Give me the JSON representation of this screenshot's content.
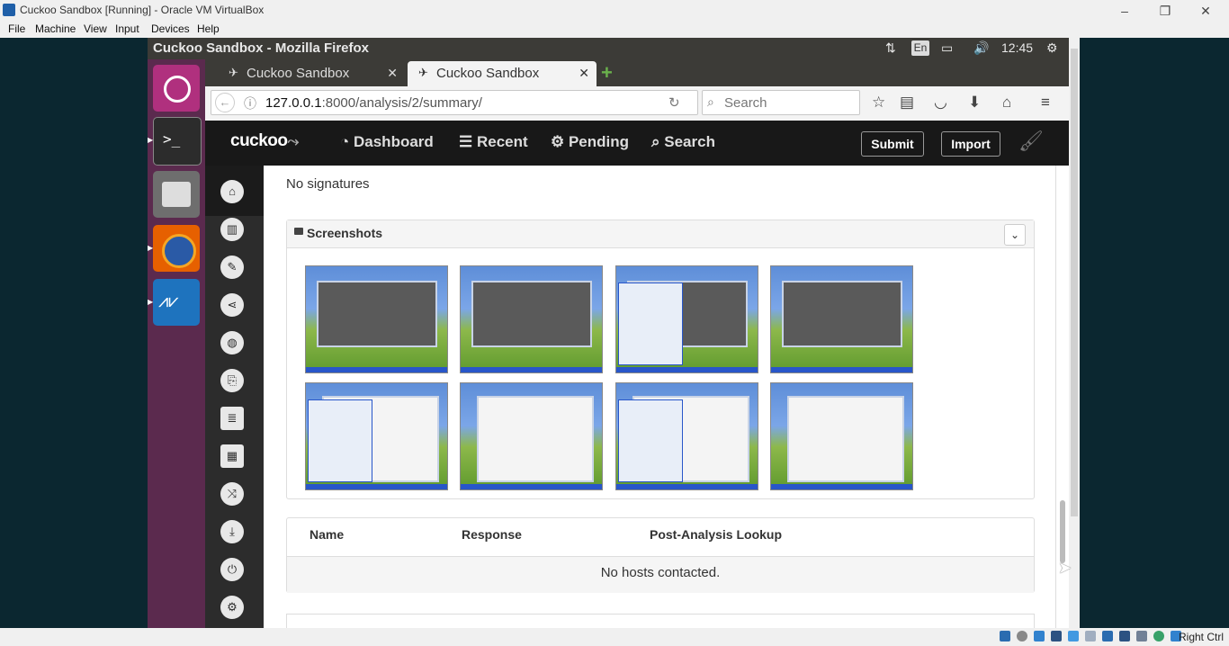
{
  "vbox": {
    "title": "Cuckoo Sandbox [Running] - Oracle VM VirtualBox",
    "menu": [
      "File",
      "Machine",
      "View",
      "Input",
      "Devices",
      "Help"
    ],
    "win_minimize": "–",
    "win_restore": "❐",
    "win_close": "✕",
    "status_right": "Right Ctrl"
  },
  "ubuntu": {
    "window_title": "Cuckoo Sandbox - Mozilla Firefox",
    "keyboard": "En",
    "time": "12:45"
  },
  "firefox": {
    "tabs": [
      {
        "label": "Cuckoo Sandbox",
        "close": "✕"
      },
      {
        "label": "Cuckoo Sandbox",
        "close": "✕"
      }
    ],
    "new_tab": "+",
    "url_host": "127.0.0.1",
    "url_path": ":8000/analysis/2/summary/",
    "search_placeholder": "Search"
  },
  "cuckoo": {
    "logo": "cuckoo",
    "nav": {
      "dashboard": "Dashboard",
      "recent": "Recent",
      "pending": "Pending",
      "search": "Search"
    },
    "submit": "Submit",
    "import": "Import",
    "no_signatures": "No signatures",
    "screenshots_title": "Screenshots",
    "hosts": {
      "col_name": "Name",
      "col_response": "Response",
      "col_lookup": "Post-Analysis Lookup",
      "empty": "No hosts contacted."
    }
  },
  "colors": {
    "launcher": "#5b2a4e",
    "cuckoo_header": "#181818",
    "cuckoo_sidebar": "#2c2c2c"
  }
}
